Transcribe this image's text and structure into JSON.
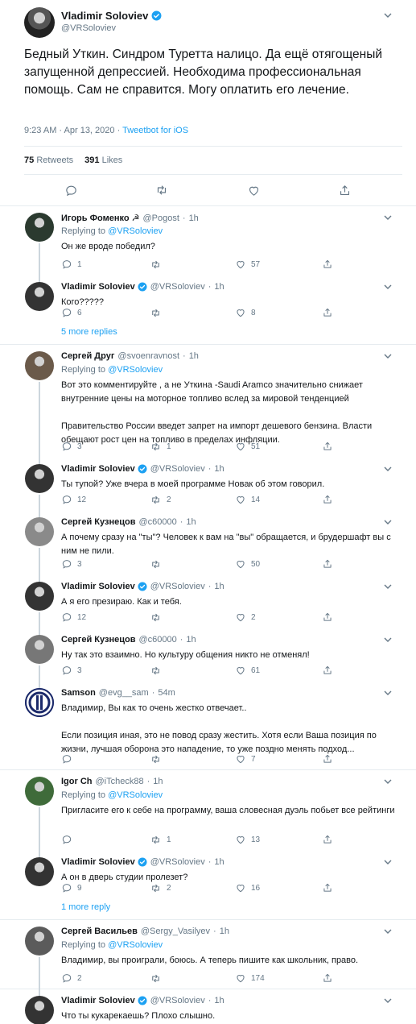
{
  "main_tweet": {
    "name": "Vladimir Soloviev",
    "handle": "@VRSoloviev",
    "text": "Бедный Уткин. Синдром Туретта налицо. Да ещё отягощеный запущенной депрессией. Необходима профессиональная помощь. Сам не справится. Могу оплатить его лечение.",
    "time": "9:23 AM · Apr 13, 2020 · ",
    "source": "Tweetbot for iOS",
    "retweets_count": "75",
    "retweets_label": "Retweets",
    "likes_count": "391",
    "likes_label": "Likes"
  },
  "replies": [
    {
      "name": "Игорь Фоменко ☭",
      "handle": "@Pogost",
      "time": "1h",
      "replying_prefix": "Replying to ",
      "replying_to": "@VRSoloviev",
      "paragraphs": [
        "Он же вроде победил?"
      ],
      "replies": "1",
      "retweets": "",
      "likes": "57"
    },
    {
      "name": "Vladimir Soloviev",
      "handle": "@VRSoloviev",
      "time": "1h",
      "paragraphs": [
        "Кого?????"
      ],
      "replies": "6",
      "retweets": "",
      "likes": "8"
    },
    {
      "name": "Сергей Друг",
      "handle": "@svoenravnost",
      "time": "1h",
      "replying_prefix": "Replying to ",
      "replying_to": "@VRSoloviev",
      "paragraphs": [
        "Вот это комментируйте , а не Уткина -Saudi Aramco значительно снижает внутренние цены на моторное топливо вслед за мировой тенденцией",
        "Правительство России введет запрет на импорт дешевого бензина. Власти обещают рост цен на топливо в пределах инфляции."
      ],
      "replies": "3",
      "retweets": "1",
      "likes": "51"
    },
    {
      "name": "Vladimir Soloviev",
      "handle": "@VRSoloviev",
      "time": "1h",
      "paragraphs": [
        "Ты тупой? Уже вчера в моей программе Новак об этом говорил."
      ],
      "replies": "12",
      "retweets": "2",
      "likes": "14"
    },
    {
      "name": "Сергей Кузнецов",
      "handle": "@c60000",
      "time": "1h",
      "paragraphs": [
        "А почему сразу на \"ты\"? Человек к вам на \"вы\" обращается, и брудершафт вы с ним не пили."
      ],
      "replies": "3",
      "retweets": "",
      "likes": "50"
    },
    {
      "name": "Vladimir Soloviev",
      "handle": "@VRSoloviev",
      "time": "1h",
      "paragraphs": [
        "А я его презираю. Как и тебя."
      ],
      "replies": "12",
      "retweets": "",
      "likes": "2"
    },
    {
      "name": "Сергей Кузнецов",
      "handle": "@c60000",
      "time": "1h",
      "paragraphs": [
        "Ну так это взаимно. Но культуру общения никто не отменял!"
      ],
      "replies": "3",
      "retweets": "",
      "likes": "61"
    },
    {
      "name": "Samson",
      "handle": "@evg__sam",
      "time": "54m",
      "paragraphs": [
        "Владимир, Вы как то очень жестко отвечает..",
        "Если позиция иная, это не повод сразу жестить.   Хотя если Ваша позиция по жизни, лучшая оборона это нападение, то уже поздно менять подход..."
      ],
      "replies": "",
      "retweets": "",
      "likes": "7"
    },
    {
      "name": "Igor Ch",
      "handle": "@iTcheck88",
      "time": "1h",
      "replying_prefix": "Replying to ",
      "replying_to": "@VRSoloviev",
      "paragraphs": [
        "Пригласите его к себе на программу, ваша словесная дуэль побьет все рейтинги"
      ],
      "replies": "",
      "retweets": "1",
      "likes": "13"
    },
    {
      "name": "Vladimir Soloviev",
      "handle": "@VRSoloviev",
      "time": "1h",
      "paragraphs": [
        "А он в дверь студии пролезет?"
      ],
      "replies": "9",
      "retweets": "2",
      "likes": "16"
    },
    {
      "name": "Сергей Васильев",
      "handle": "@Sergy_Vasilyev",
      "time": "1h",
      "replying_prefix": "Replying to ",
      "replying_to": "@VRSoloviev",
      "paragraphs": [
        "Владимир, вы проиграли, боюсь. А теперь пишите как школьник, право."
      ],
      "replies": "2",
      "retweets": "",
      "likes": "174"
    },
    {
      "name": "Vladimir Soloviev",
      "handle": "@VRSoloviev",
      "time": "1h",
      "paragraphs": [
        "Что ты кукарекаешь? Плохо слышно."
      ],
      "replies": "",
      "retweets": "",
      "likes": ""
    }
  ],
  "more_replies": [
    {
      "label": "5 more replies"
    },
    {
      "label": "1 more reply"
    }
  ],
  "separators": {
    "dot": "·"
  },
  "colors": {
    "accent": "#1da1f2",
    "muted": "#657786",
    "border": "#e6ecf0",
    "text": "#14171a"
  }
}
